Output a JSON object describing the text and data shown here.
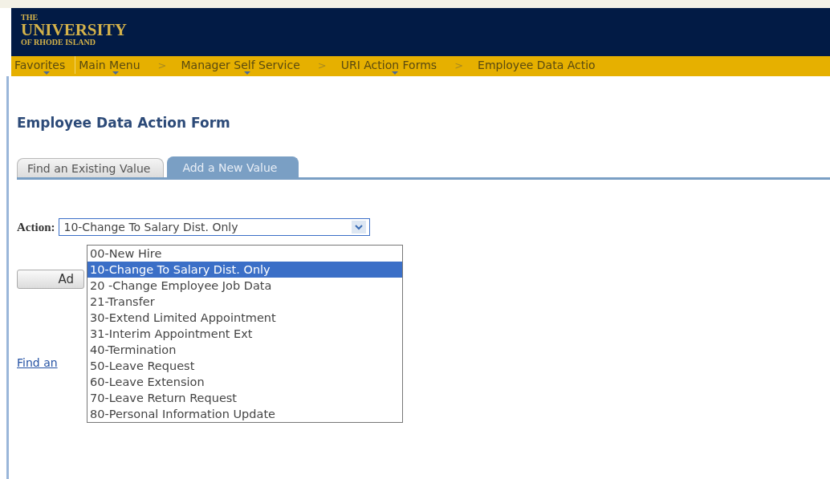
{
  "header": {
    "logo_lines": [
      "THE",
      "UNIVERSITY",
      "OF RHODE ISLAND"
    ]
  },
  "nav": [
    {
      "label": "Favorites",
      "kind": "menu"
    },
    {
      "label": "Main Menu",
      "kind": "menu"
    },
    {
      "label": ">",
      "kind": "separator"
    },
    {
      "label": "Manager Self Service",
      "kind": "menu"
    },
    {
      "label": ">",
      "kind": "separator"
    },
    {
      "label": "URI Action Forms",
      "kind": "menu"
    },
    {
      "label": ">",
      "kind": "separator"
    },
    {
      "label": "Employee Data Actio",
      "kind": "page"
    }
  ],
  "page_title": "Employee Data Action Form",
  "tabs": [
    {
      "label": "Find an Existing Value",
      "selected": false
    },
    {
      "label": "Add a New Value",
      "selected": true
    }
  ],
  "action": {
    "label": "Action:",
    "value": "10-Change To Salary Dist. Only",
    "expanded": true,
    "options": [
      {
        "label": "00-New Hire",
        "selected": false
      },
      {
        "label": "10-Change To Salary Dist. Only",
        "selected": true
      },
      {
        "label": "20 -Change Employee Job Data",
        "selected": false
      },
      {
        "label": "21-Transfer",
        "selected": false
      },
      {
        "label": "30-Extend Limited Appointment",
        "selected": false
      },
      {
        "label": "31-Interim Appointment Ext",
        "selected": false
      },
      {
        "label": "40-Termination",
        "selected": false
      },
      {
        "label": "50-Leave Request",
        "selected": false
      },
      {
        "label": "60-Leave Extension",
        "selected": false
      },
      {
        "label": "70-Leave Return Request",
        "selected": false
      },
      {
        "label": "80-Personal Information Update",
        "selected": false
      }
    ]
  },
  "add_button": "Ad",
  "find_link": "Find an"
}
